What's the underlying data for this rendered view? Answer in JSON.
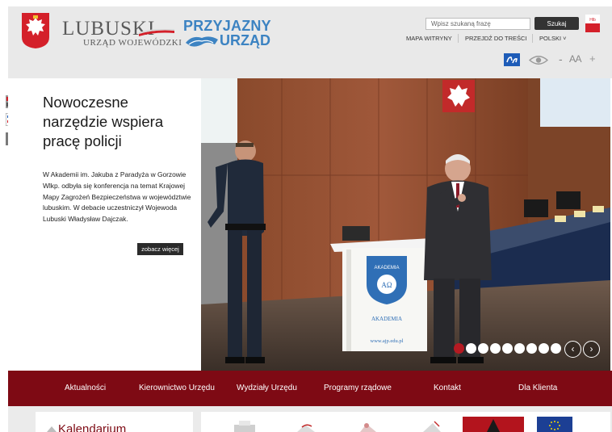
{
  "header": {
    "logo_name": "LUBUSKI",
    "logo_subtitle": "URZĄD WOJEWÓDZKI",
    "badge_top": "PRZYJAZNY",
    "badge_bottom": "URZĄD",
    "search": {
      "placeholder": "Wpisz szukaną frazę",
      "button_label": "Szukaj"
    },
    "lang_flag_label": "Hlb",
    "links": {
      "sitemap": "MAPA WITRYNY",
      "skip": "PRZEJDŹ DO TREŚCI",
      "language": "POLSKI ˅"
    },
    "accessibility": {
      "decrease": "-",
      "font_size": "AA",
      "increase": "+"
    }
  },
  "hero": {
    "title": "Nowoczesne narzędzie wspiera pracę policji",
    "description": "W Akademii im. Jakuba z Paradyża w Gorzowie Wlkp. odbyła się konferencja na temat Krajowej Mapy Zagrożeń Bezpieczeństwa w województwie lubuskim. W debacie uczestniczył Wojewoda Lubuski Władysław Dajczak.",
    "more_label": "zobacz więcej",
    "slides_total": 9,
    "active_slide": 1,
    "photo_lectern_line1": "AKADEMIA",
    "photo_lectern_url": "www.ajp.edu.pl",
    "prev_arrow": "‹",
    "next_arrow": "›"
  },
  "side_icons": [
    "bip-icon",
    "epuap-icon",
    "facebook-icon"
  ],
  "nav": {
    "items": [
      "Aktualności",
      "Kierownictwo Urzędu",
      "Wydziały Urzędu",
      "Programy rządowe",
      "Kontakt",
      "Dla Klienta"
    ]
  },
  "bottom": {
    "calendar_title": "Kalendarium"
  },
  "colors": {
    "brand_red": "#7e0a14",
    "badge_blue": "#3c83c2",
    "active_dot": "#b51a22",
    "header_bg": "#e9e9e9"
  }
}
